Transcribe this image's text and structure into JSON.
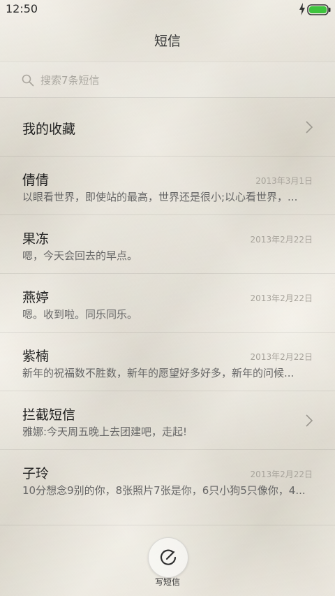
{
  "status_bar": {
    "time": "12:50",
    "icons": [
      "charging-icon",
      "battery-icon"
    ]
  },
  "header": {
    "title": "短信"
  },
  "search": {
    "placeholder": "搜索7条短信",
    "icon": "search-icon"
  },
  "favorites": {
    "label": "我的收藏"
  },
  "conversations": [
    {
      "name": "倩倩",
      "date": "2013年3月1日",
      "preview": "以眼看世界，即使站的最高，世界还是很小;以心看世界，..."
    },
    {
      "name": "果冻",
      "date": "2013年2月22日",
      "preview": "嗯，今天会回去的早点。"
    },
    {
      "name": "燕婷",
      "date": "2013年2月22日",
      "preview": "嗯。收到啦。同乐同乐。"
    },
    {
      "name": "紫楠",
      "date": "2013年2月22日",
      "preview": "新年的祝福数不胜数，新年的愿望好多好多，新年的问候..."
    }
  ],
  "blocked": {
    "label": "拦截短信",
    "preview": "雅娜:今天周五晚上去团建吧，走起!"
  },
  "last_conversation": {
    "name": "子玲",
    "date": "2013年2月22日",
    "preview": "10分想念9别的你，8张照片7张是你，6只小狗5只像你，4..."
  },
  "compose": {
    "label": "写短信",
    "icon": "compose-icon"
  },
  "colors": {
    "battery": "#3ec43e",
    "paper": "#ece7da"
  }
}
